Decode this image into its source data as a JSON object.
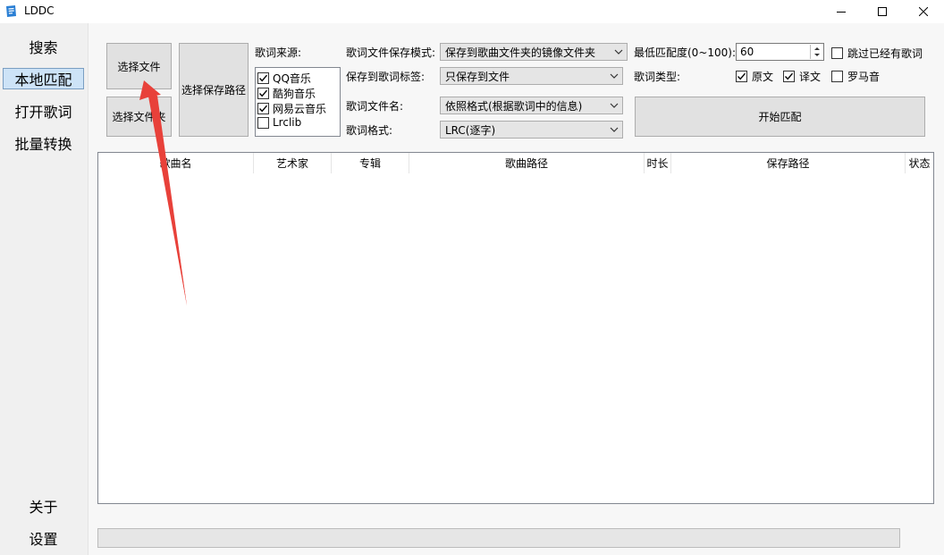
{
  "window": {
    "title": "LDDC",
    "icon": "app-lyrics-icon",
    "controls": [
      "minimize-icon",
      "maximize-icon",
      "close-icon"
    ]
  },
  "sidebar": {
    "items": [
      {
        "label": "搜索",
        "active": false
      },
      {
        "label": "本地匹配",
        "active": true
      },
      {
        "label": "打开歌词",
        "active": false
      },
      {
        "label": "批量转换",
        "active": false
      }
    ],
    "bottom_items": [
      {
        "label": "关于"
      },
      {
        "label": "设置"
      }
    ]
  },
  "toolbar": {
    "select_file": "选择文件",
    "select_folder": "选择文件夹",
    "select_save_path": "选择保存路径",
    "start_match": "开始匹配"
  },
  "sources": {
    "label": "歌词来源:",
    "items": [
      {
        "label": "QQ音乐",
        "checked": true
      },
      {
        "label": "酷狗音乐",
        "checked": true
      },
      {
        "label": "网易云音乐",
        "checked": true
      },
      {
        "label": "Lrclib",
        "checked": false
      }
    ]
  },
  "options": {
    "save_mode_label": "歌词文件保存模式:",
    "save_mode_value": "保存到歌曲文件夹的镜像文件夹",
    "save_tag_label": "保存到歌词标签:",
    "save_tag_value": "只保存到文件",
    "filename_label": "歌词文件名:",
    "filename_value": "依照格式(根据歌词中的信息)",
    "format_label": "歌词格式:",
    "format_value": "LRC(逐字)",
    "min_score_label": "最低匹配度(0~100):",
    "min_score_value": "60",
    "skip_existing_label": "跳过已经有歌词",
    "skip_existing_checked": false,
    "lyric_type_label": "歌词类型:",
    "lyric_types": [
      {
        "label": "原文",
        "checked": true
      },
      {
        "label": "译文",
        "checked": true
      },
      {
        "label": "罗马音",
        "checked": false
      }
    ]
  },
  "table": {
    "columns": [
      "歌曲名",
      "艺术家",
      "专辑",
      "歌曲路径",
      "时长",
      "保存路径",
      "状态"
    ],
    "rows": []
  },
  "progress": {
    "value": 0
  },
  "colors": {
    "annotation_arrow": "#e8413a",
    "active_nav_bg": "#cde3f7"
  }
}
